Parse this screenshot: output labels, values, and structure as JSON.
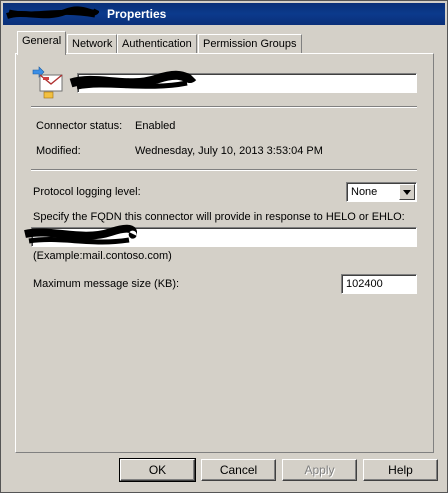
{
  "window": {
    "title": "Properties"
  },
  "tabs": [
    {
      "label": "General",
      "active": true
    },
    {
      "label": "Network"
    },
    {
      "label": "Authentication"
    },
    {
      "label": "Permission Groups"
    }
  ],
  "general": {
    "connector_status_label": "Connector status:",
    "connector_status_value": "Enabled",
    "modified_label": "Modified:",
    "modified_value": "Wednesday, July 10, 2013 3:53:04 PM",
    "protocol_logging_label": "Protocol logging level:",
    "protocol_logging_value": "None",
    "fqdn_label": "Specify the FQDN this connector will provide in response to HELO or EHLO:",
    "fqdn_example": "(Example:mail.contoso.com)",
    "max_size_label": "Maximum message size (KB):",
    "max_size_value": "102400"
  },
  "buttons": {
    "ok": "OK",
    "cancel": "Cancel",
    "apply": "Apply",
    "help": "Help"
  },
  "icons": {
    "connector": "connector-icon",
    "dropdown": "chevron-down-icon"
  },
  "colors": {
    "titlebar": "#0a2f78",
    "dialog": "#d4d0c8"
  }
}
